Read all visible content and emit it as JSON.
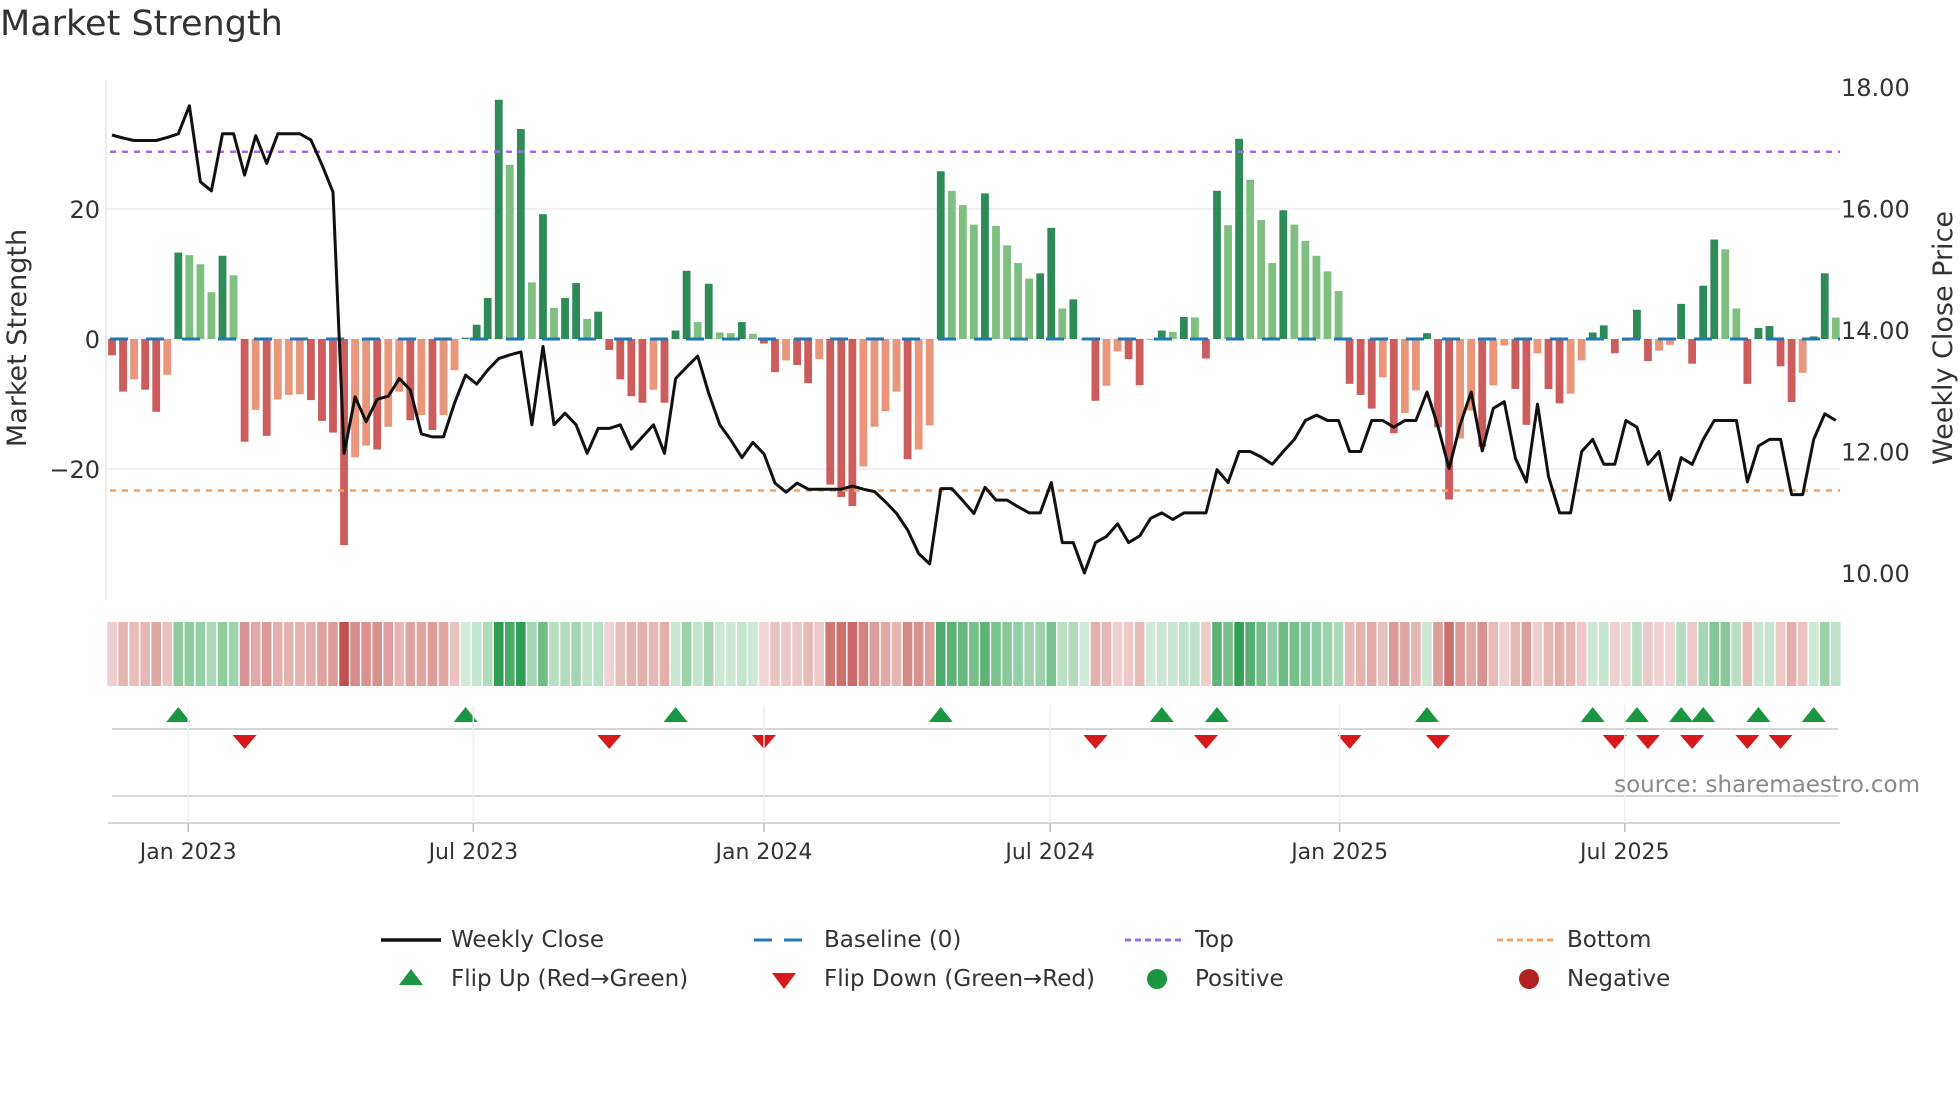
{
  "title": "Market Strength",
  "source": "source: sharemaestro.com",
  "chart_data": {
    "type": "bar+line",
    "title": "Market Strength",
    "ylabel_left": "Market Strength",
    "ylabel_right": "Weekly Close Price",
    "ylim_left": [
      -40,
      39
    ],
    "ylim_right": [
      9.75,
      18.2
    ],
    "left_ticks": [
      {
        "v": 20,
        "label": "20"
      },
      {
        "v": 0,
        "label": "0"
      },
      {
        "v": -20,
        "label": "−20"
      }
    ],
    "right_ticks": [
      {
        "v": 18,
        "label": "18.00"
      },
      {
        "v": 16,
        "label": "16.00"
      },
      {
        "v": 14,
        "label": "14.00"
      },
      {
        "v": 12,
        "label": "12.00"
      },
      {
        "v": 10,
        "label": "10.00"
      }
    ],
    "x_ticks": [
      {
        "week": 6.9,
        "label": "Jan 2023"
      },
      {
        "week": 32.7,
        "label": "Jul 2023"
      },
      {
        "week": 59.0,
        "label": "Jan 2024"
      },
      {
        "week": 84.9,
        "label": "Jul 2024"
      },
      {
        "week": 111.1,
        "label": "Jan 2025"
      },
      {
        "week": 136.9,
        "label": "Jul 2025"
      }
    ],
    "top_level": 28.8,
    "bottom_level": -23.3,
    "baseline": 0,
    "strength": [
      -2.5,
      -8.1,
      -6.2,
      -7.8,
      -11.2,
      -5.5,
      13.3,
      12.9,
      11.5,
      7.2,
      12.8,
      9.8,
      -15.8,
      -10.9,
      -14.9,
      -9.3,
      -8.6,
      -8.5,
      -9.4,
      -12.6,
      -14.4,
      -31.7,
      -18.2,
      -16.4,
      -17.0,
      -13.5,
      -8.1,
      -12.5,
      -11.7,
      -14.0,
      -11.7,
      -4.8,
      0.2,
      2.2,
      6.3,
      36.8,
      26.8,
      32.3,
      8.7,
      19.2,
      4.8,
      6.3,
      8.6,
      3.1,
      4.2,
      -1.7,
      -6.2,
      -8.8,
      -9.8,
      -7.8,
      -9.8,
      1.3,
      10.5,
      2.6,
      8.5,
      1.0,
      0.9,
      2.6,
      0.8,
      -0.7,
      -5.1,
      -3.3,
      -4.0,
      -6.8,
      -3.1,
      -22.4,
      -24.3,
      -25.7,
      -19.6,
      -13.5,
      -11.1,
      -8.1,
      -18.5,
      -17.0,
      -13.3,
      25.8,
      22.8,
      20.6,
      17.6,
      22.4,
      17.4,
      14.4,
      11.7,
      9.3,
      10.1,
      17.1,
      4.7,
      6.1,
      0,
      -9.5,
      -7.2,
      -1.9,
      -3.1,
      -7.1,
      0,
      1.3,
      1.1,
      3.4,
      3.3,
      -3.0,
      22.8,
      17.5,
      30.8,
      24.5,
      18.3,
      11.7,
      19.8,
      17.6,
      15.1,
      12.8,
      10.4,
      7.4,
      -6.9,
      -8.6,
      -10.7,
      -5.9,
      -14.5,
      -11.4,
      -7.9,
      0.9,
      -13.6,
      -24.7,
      -15.3,
      -11.0,
      -16.6,
      -7.1,
      -1.0,
      -7.7,
      -13.2,
      -2.2,
      -7.7,
      -9.9,
      -8.4,
      -3.3,
      1.0,
      2.1,
      -2.2,
      -0.3,
      4.5,
      -3.4,
      -1.8,
      -0.9,
      5.4,
      -3.8,
      8.2,
      15.3,
      13.8,
      4.7,
      -6.9,
      1.7,
      2.0,
      -4.2,
      -9.7,
      -5.2,
      0.4,
      10.1,
      3.3
    ],
    "weekly_close": [
      17.21,
      17.16,
      17.12,
      17.12,
      17.12,
      17.17,
      17.23,
      17.69,
      16.44,
      16.29,
      17.23,
      17.23,
      16.55,
      17.2,
      16.74,
      17.23,
      17.23,
      17.23,
      17.13,
      16.72,
      16.27,
      11.97,
      12.9,
      12.49,
      12.86,
      12.91,
      13.2,
      13.01,
      12.29,
      12.24,
      12.24,
      12.8,
      13.26,
      13.11,
      13.34,
      13.53,
      13.59,
      13.64,
      12.44,
      13.73,
      12.44,
      12.63,
      12.44,
      11.97,
      12.38,
      12.38,
      12.44,
      12.04,
      12.24,
      12.44,
      11.97,
      13.2,
      13.39,
      13.57,
      12.96,
      12.44,
      12.19,
      11.9,
      12.15,
      11.96,
      11.48,
      11.33,
      11.48,
      11.38,
      11.38,
      11.38,
      11.38,
      11.43,
      11.38,
      11.34,
      11.17,
      10.98,
      10.71,
      10.32,
      10.15,
      11.39,
      11.39,
      11.19,
      10.98,
      11.41,
      11.2,
      11.2,
      11.09,
      10.99,
      10.99,
      11.49,
      10.5,
      10.5,
      10.0,
      10.5,
      10.6,
      10.81,
      10.5,
      10.61,
      10.9,
      10.99,
      10.88,
      10.99,
      10.99,
      10.99,
      11.7,
      11.49,
      12.0,
      12.0,
      11.91,
      11.79,
      12.0,
      12.2,
      12.51,
      12.6,
      12.51,
      12.51,
      12.0,
      12.0,
      12.51,
      12.51,
      12.4,
      12.51,
      12.51,
      12.98,
      12.41,
      11.72,
      12.44,
      12.98,
      12.01,
      12.71,
      12.82,
      11.89,
      11.5,
      12.78,
      11.59,
      10.99,
      10.99,
      12.0,
      12.2,
      11.79,
      11.79,
      12.51,
      12.4,
      11.79,
      12.0,
      11.2,
      11.9,
      11.79,
      12.2,
      12.51,
      12.51,
      12.51,
      11.5,
      12.09,
      12.2,
      12.2,
      11.29,
      11.29,
      12.2,
      12.62,
      12.51
    ],
    "flip_up_weeks": [
      7,
      33,
      52,
      76,
      96,
      101,
      120,
      135,
      139,
      143,
      145,
      150,
      155
    ],
    "flip_down_weeks": [
      13,
      46,
      60,
      90,
      100,
      113,
      121,
      137,
      140,
      144,
      149,
      152
    ],
    "colors": {
      "pos_strong": "#2e8b57",
      "pos_weak": "#7fbf7f",
      "neg_strong": "#cd5c5c",
      "neg_weak": "#e9967a",
      "close": "#111111",
      "baseline": "#1f77b4",
      "top": "#9b6fe0",
      "bottom": "#f4a460",
      "flip_up": "#1a9641",
      "flip_down": "#d7191c",
      "positive": "#1a9641",
      "negative": "#b22222"
    },
    "legend": {
      "placement": "bottom",
      "items": [
        {
          "key": "close",
          "label": "Weekly Close"
        },
        {
          "key": "baseline",
          "label": "Baseline (0)"
        },
        {
          "key": "top",
          "label": "Top"
        },
        {
          "key": "bottom",
          "label": "Bottom"
        },
        {
          "key": "flip_up",
          "label": "Flip Up (Red→Green)"
        },
        {
          "key": "flip_down",
          "label": "Flip Down (Green→Red)"
        },
        {
          "key": "positive",
          "label": "Positive"
        },
        {
          "key": "negative",
          "label": "Negative"
        }
      ]
    }
  }
}
